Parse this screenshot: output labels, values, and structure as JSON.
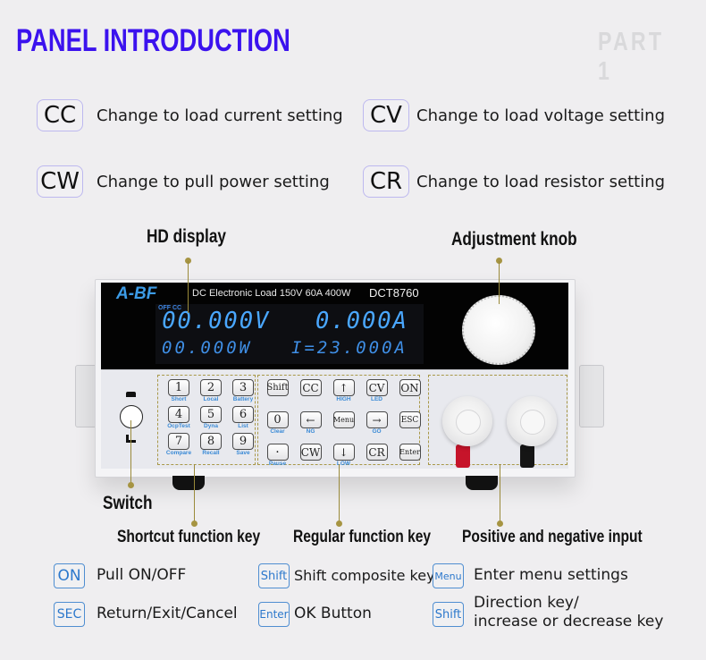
{
  "header": {
    "title": "PANEL INTRODUCTION",
    "part": "PART 1"
  },
  "modes": [
    {
      "key": "CC",
      "description": "Change to load current setting"
    },
    {
      "key": "CV",
      "description": "Change to load voltage setting"
    },
    {
      "key": "CW",
      "description": "Change to pull power setting"
    },
    {
      "key": "CR",
      "description": "Change to load resistor setting"
    }
  ],
  "callouts": {
    "hd_display": "HD display",
    "adjustment_knob": "Adjustment knob",
    "switch": "Switch",
    "shortcut_keys": "Shortcut function key",
    "regular_keys": "Regular function key",
    "io_terminals": "Positive and negative input"
  },
  "device": {
    "brand": "A-BF",
    "description": "DC Electronic Load 150V 60A 400W",
    "model": "DCT8760",
    "lcd": {
      "status": "OFF CC",
      "voltage": "00.000V",
      "current": "0.000A",
      "power": "00.000W",
      "setpoint": "I=23.000A"
    },
    "shortcut_keys": [
      {
        "key": "1",
        "label": "Short"
      },
      {
        "key": "2",
        "label": "Local"
      },
      {
        "key": "3",
        "label": "Battery"
      },
      {
        "key": "4",
        "label": "OcpTest"
      },
      {
        "key": "5",
        "label": "Dyna"
      },
      {
        "key": "6",
        "label": "List"
      },
      {
        "key": "7",
        "label": "Compare"
      },
      {
        "key": "8",
        "label": "Recall"
      },
      {
        "key": "9",
        "label": "Save"
      }
    ],
    "function_keys": [
      {
        "key": "Shift",
        "label": ""
      },
      {
        "key": "CC",
        "label": ""
      },
      {
        "key": "↑",
        "label": "HIGH"
      },
      {
        "key": "CV",
        "label": "LED"
      },
      {
        "key": "ON",
        "label": ""
      },
      {
        "key": "0",
        "label": "Clear"
      },
      {
        "key": "←",
        "label": "NG"
      },
      {
        "key": "Menu",
        "label": ""
      },
      {
        "key": "→",
        "label": "GO"
      },
      {
        "key": "ESC",
        "label": ""
      },
      {
        "key": "·",
        "label": "Pause"
      },
      {
        "key": "CW",
        "label": ""
      },
      {
        "key": "↓",
        "label": "LOW"
      },
      {
        "key": "CR",
        "label": ""
      },
      {
        "key": "Enter",
        "label": ""
      }
    ]
  },
  "legend": [
    {
      "key": "ON",
      "description": "Pull ON/OFF"
    },
    {
      "key": "Shift",
      "description": "Shift composite key"
    },
    {
      "key": "Menu",
      "description": "Enter menu settings"
    },
    {
      "key": "SEC",
      "description": "Return/Exit/Cancel"
    },
    {
      "key": "Enter",
      "description": "OK Button"
    },
    {
      "key": "Shift",
      "description_line1": "Direction key/",
      "description_line2": "increase or decrease key"
    }
  ],
  "colors": {
    "title": "#3b12ee",
    "part": "#d9d9db",
    "lcd": "#4aa7ff",
    "key_label": "#3a8ad6",
    "legend_accent": "#2c78cc",
    "callout_line": "#a69442"
  }
}
